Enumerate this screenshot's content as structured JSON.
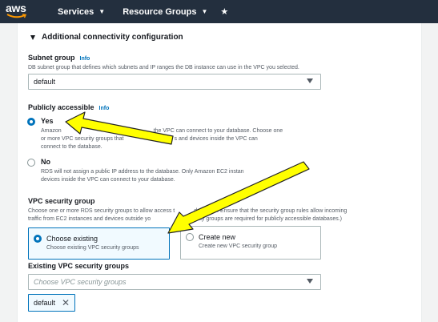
{
  "topnav": {
    "logo_text": "aws",
    "services_label": "Services",
    "resource_groups_label": "Resource Groups",
    "pin_icon": "★"
  },
  "section": {
    "title": "Additional connectivity configuration"
  },
  "subnet": {
    "label": "Subnet group",
    "info": "Info",
    "description": "DB subnet group that defines which subnets and IP ranges the DB instance can use in the VPC you selected.",
    "value": "default"
  },
  "public": {
    "label": "Publicly accessible",
    "info": "Info",
    "yes_label": "Yes",
    "yes_desc_line1": "Amazon",
    "yes_desc_line1b": "the VPC can connect to your database. Choose one",
    "yes_desc_line2": "or more VPC security groups that",
    "yes_desc_line2b": "s and devices inside the VPC can",
    "yes_desc_line3": "connect to the database.",
    "no_label": "No",
    "no_desc_line1": "RDS will not assign a public IP address to the database. Only Amazon EC2 instan",
    "no_desc_line2": "devices inside the VPC can connect to your database."
  },
  "vpc_sg": {
    "label": "VPC security group",
    "desc_line1a": "Choose one or more RDS security groups to allow access t",
    "desc_line1b": "database. Ensure that the security group rules allow incoming",
    "desc_line2a": "traffic from EC2 instances and devices outside yo",
    "desc_line2b": "urity groups are required for publicly accessible databases.)",
    "choose_existing_title": "Choose existing",
    "choose_existing_desc": "Choose existing VPC security groups",
    "create_new_title": "Create new",
    "create_new_desc": "Create new VPC security group"
  },
  "existing_sg": {
    "label": "Existing VPC security groups",
    "placeholder": "Choose VPC security groups",
    "token": "default",
    "remove_icon": "✕"
  },
  "colors": {
    "nav_bg": "#232f3e",
    "accent": "#0073bb",
    "annotation_arrow": "#ffff00"
  }
}
